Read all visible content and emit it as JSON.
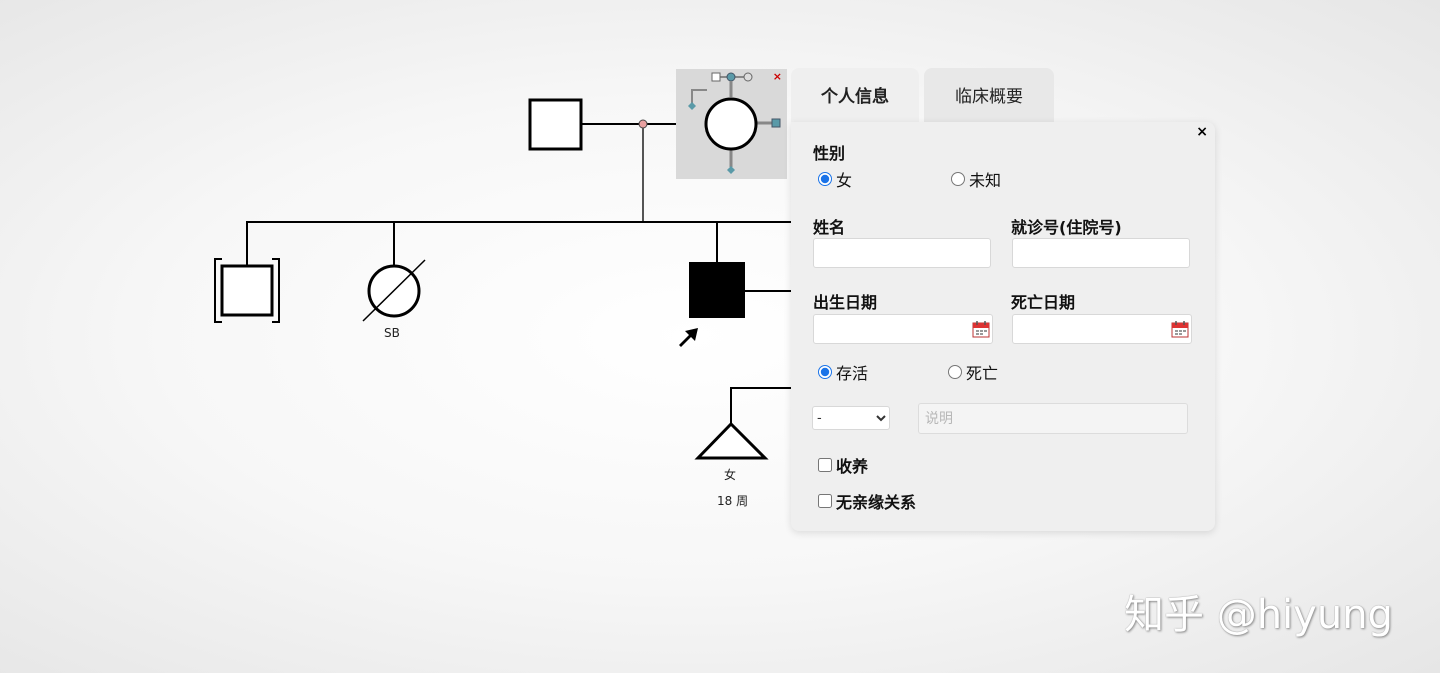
{
  "pedigree": {
    "stillbirth_label": "SB",
    "fetus_sex_label": "女",
    "fetus_age_label": "18 周"
  },
  "node_menu": {
    "close_label": "×"
  },
  "dialog": {
    "tabs": [
      {
        "label": "个人信息",
        "active": true
      },
      {
        "label": "临床概要",
        "active": false
      }
    ],
    "close_label": "×",
    "sex": {
      "label": "性别",
      "options": [
        "女",
        "未知"
      ],
      "selected": "女"
    },
    "name_label": "姓名",
    "name_value": "",
    "record_label": "就诊号(住院号)",
    "record_value": "",
    "birth_date_label": "出生日期",
    "birth_date_value": "",
    "death_date_label": "死亡日期",
    "death_date_value": "",
    "life_status": {
      "options": [
        "存活",
        "死亡"
      ],
      "selected": "存活"
    },
    "status_select_value": "-",
    "note_placeholder": "说明",
    "adopted_label": "收养",
    "adopted_checked": false,
    "no_relation_label": "无亲缘关系",
    "no_relation_checked": false
  },
  "watermark": "知乎 @hiyung",
  "colors": {
    "accent": "#1a73e8",
    "consanguinity_dot": "#e8a0a0",
    "menu_handle": "#5a9aa8"
  }
}
